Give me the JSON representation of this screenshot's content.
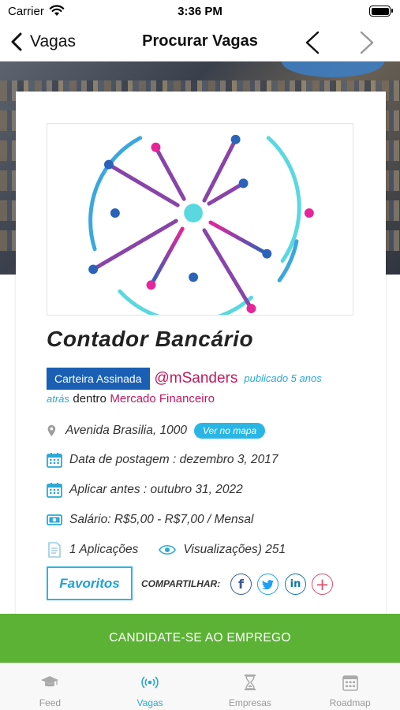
{
  "status_bar": {
    "carrier": "Carrier",
    "time": "3:36 PM"
  },
  "nav": {
    "back_label": "Vagas",
    "title": "Procurar Vagas"
  },
  "job": {
    "title": "Contador Bancário",
    "contract_type": "Carteira Assinada",
    "author": "@mSanders",
    "published_prefix": "publicado 5 anos",
    "published_suffix": "atrás",
    "inside_label": "dentro",
    "category": "Mercado Financeiro",
    "address": "Avenida Brasilia, 1000",
    "map_button": "Ver no mapa",
    "posted_date": "Data de postagem : dezembro 3, 2017",
    "apply_before": "Aplicar antes : outubro 31, 2022",
    "salary": "Salário: R$5,00 - R$7,00 / Mensal",
    "applications": "1 Aplicações",
    "views": "Visualizações) 251"
  },
  "actions": {
    "favorites_label": "Favoritos",
    "share_label": "COMPARTILHAR:",
    "share_icons": [
      "facebook-icon",
      "twitter-icon",
      "linkedin-icon",
      "plus-icon"
    ],
    "apply_label": "CANDIDATE-SE AO EMPREGO"
  },
  "tabs": [
    {
      "label": "Feed",
      "icon": "graduation-cap-icon",
      "active": false
    },
    {
      "label": "Vagas",
      "icon": "broadcast-icon",
      "active": true
    },
    {
      "label": "Empresas",
      "icon": "hourglass-icon",
      "active": false
    },
    {
      "label": "Roadmap",
      "icon": "calendar-icon",
      "active": false
    }
  ],
  "colors": {
    "accent": "#29b6e5",
    "author": "#c2185b",
    "badge": "#1a5fb4",
    "apply": "#5bb234",
    "logo_cyan": "#5ad8e0",
    "logo_pink": "#e6259a",
    "logo_blue": "#2a63b8"
  }
}
